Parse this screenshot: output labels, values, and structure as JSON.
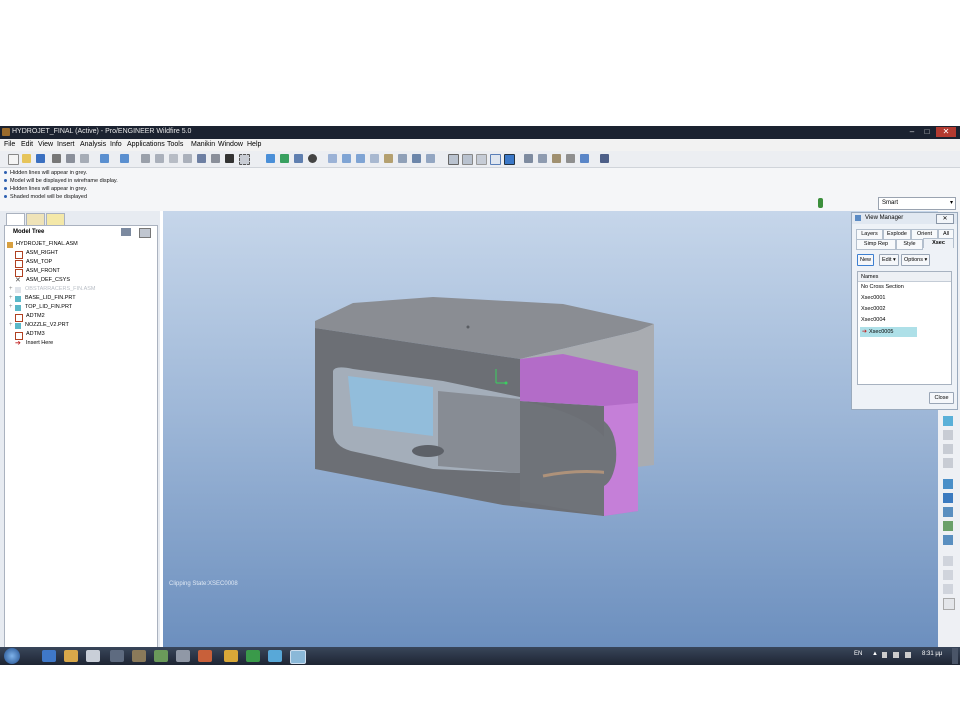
{
  "window": {
    "title": "HYDROJET_FINAL (Active) - Pro/ENGINEER Wildfire 5.0",
    "minimize": "–",
    "maximize": "□",
    "close": "✕"
  },
  "menu": [
    "File",
    "Edit",
    "View",
    "Insert",
    "Analysis",
    "Info",
    "Applications",
    "Tools",
    "Manikin",
    "Window",
    "Help"
  ],
  "messages": [
    "Hidden lines will appear in grey.",
    "Model will be displayed in wireframe display.",
    "Hidden lines will appear in grey.",
    "Shaded model will be displayed"
  ],
  "filter": {
    "value": "Smart"
  },
  "model_tree": {
    "title": "Model Tree",
    "items": [
      {
        "label": "HYDROJET_FINAL.ASM",
        "icon": "assembly-icon"
      },
      {
        "label": "ASM_RIGHT",
        "icon": "datum-plane-icon"
      },
      {
        "label": "ASM_TOP",
        "icon": "datum-plane-icon"
      },
      {
        "label": "ASM_FRONT",
        "icon": "datum-plane-icon"
      },
      {
        "label": "ASM_DEF_CSYS",
        "icon": "csys-icon"
      },
      {
        "label": "OBSTARRACERS_FIN.ASM",
        "icon": "assembly-icon"
      },
      {
        "label": "BASE_LID_FIN.PRT",
        "icon": "part-icon"
      },
      {
        "label": "TOP_LID_FIN.PRT",
        "icon": "part-icon"
      },
      {
        "label": "ADTM2",
        "icon": "datum-plane-icon"
      },
      {
        "label": "NOZZLE_V2.PRT",
        "icon": "part-icon"
      },
      {
        "label": "ADTM3",
        "icon": "datum-plane-icon"
      },
      {
        "label": "Insert Here",
        "icon": "insert-arrow-icon"
      }
    ]
  },
  "viewport": {
    "status": "Clipping State:XSEC0008"
  },
  "view_manager": {
    "title": "View Manager",
    "tabs_row1": [
      "Layers",
      "Explode",
      "Orient",
      "All"
    ],
    "tabs_row2": [
      "Simp Rep",
      "Style",
      "Xsec"
    ],
    "active_tab": "Xsec",
    "buttons": {
      "new": "New",
      "edit": "Edit",
      "options": "Options"
    },
    "list_header": "Names",
    "items": [
      "No Cross Section",
      "Xsec0001",
      "Xsec0002",
      "Xsec0004",
      "Xsec0005"
    ],
    "selected": "Xsec0005",
    "close": "Close"
  },
  "taskbar": {
    "lang": "EN",
    "time": "8:31 μμ"
  },
  "colors": {
    "accent": "#2d5fb0",
    "section_cut": "#b36cc8",
    "viewport_top": "#c6d6ea",
    "viewport_bottom": "#6c8fbe"
  }
}
